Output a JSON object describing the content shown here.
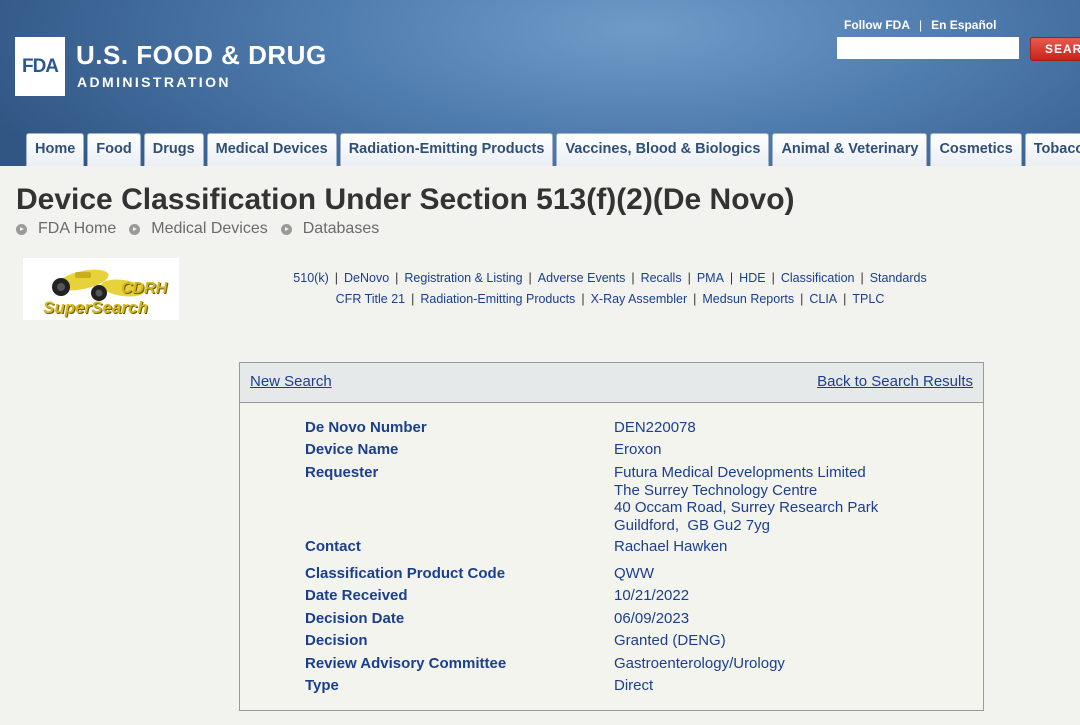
{
  "header": {
    "logo": "FDA",
    "agency_name": "U.S. FOOD & DRUG",
    "agency_subname": "ADMINISTRATION",
    "follow_link": "Follow FDA",
    "spanish_link": "En Español",
    "search_placeholder": "",
    "search_button": "SEARCH"
  },
  "nav": {
    "tabs": [
      "Home",
      "Food",
      "Drugs",
      "Medical Devices",
      "Radiation-Emitting Products",
      "Vaccines, Blood & Biologics",
      "Animal & Veterinary",
      "Cosmetics",
      "Tobacco Products"
    ]
  },
  "page": {
    "title": "Device Classification Under Section 513(f)(2)(De Novo)",
    "breadcrumb": [
      "FDA Home",
      "Medical Devices",
      "Databases"
    ]
  },
  "cdrh_logo": {
    "line1": "CDRH",
    "line2": "SuperSearch"
  },
  "quick_links": {
    "row1": [
      "510(k)",
      "DeNovo",
      "Registration & Listing",
      "Adverse Events",
      "Recalls",
      "PMA",
      "HDE",
      "Classification",
      "Standards"
    ],
    "row2": [
      "CFR Title 21",
      "Radiation-Emitting Products",
      "X-Ray Assembler",
      "Medsun Reports",
      "CLIA",
      "TPLC"
    ]
  },
  "result": {
    "new_search": "New Search",
    "back_to_results": "Back to Search Results",
    "fields": [
      {
        "label": "De Novo Number",
        "value": [
          "DEN220078"
        ]
      },
      {
        "label": "Device Name",
        "value": [
          "Eroxon"
        ]
      },
      {
        "label": "Requester",
        "value": [
          "Futura Medical Developments Limited",
          "The Surrey Technology Centre",
          "40 Occam Road, Surrey Research Park",
          "Guildford,  GB Gu2 7yg"
        ]
      },
      {
        "label": "Contact",
        "value": [
          "Rachael Hawken"
        ]
      },
      {
        "label": "Classification Product Code",
        "value": [
          "QWW"
        ]
      },
      {
        "label": "Date Received",
        "value": [
          "10/21/2022"
        ]
      },
      {
        "label": "Decision Date",
        "value": [
          "06/09/2023"
        ]
      },
      {
        "label": "Decision",
        "value": [
          "Granted (DENG)"
        ]
      },
      {
        "label": "Review Advisory Committee",
        "value": [
          "Gastroenterology/Urology"
        ]
      },
      {
        "label": "Type",
        "value": [
          "Direct"
        ]
      }
    ]
  }
}
